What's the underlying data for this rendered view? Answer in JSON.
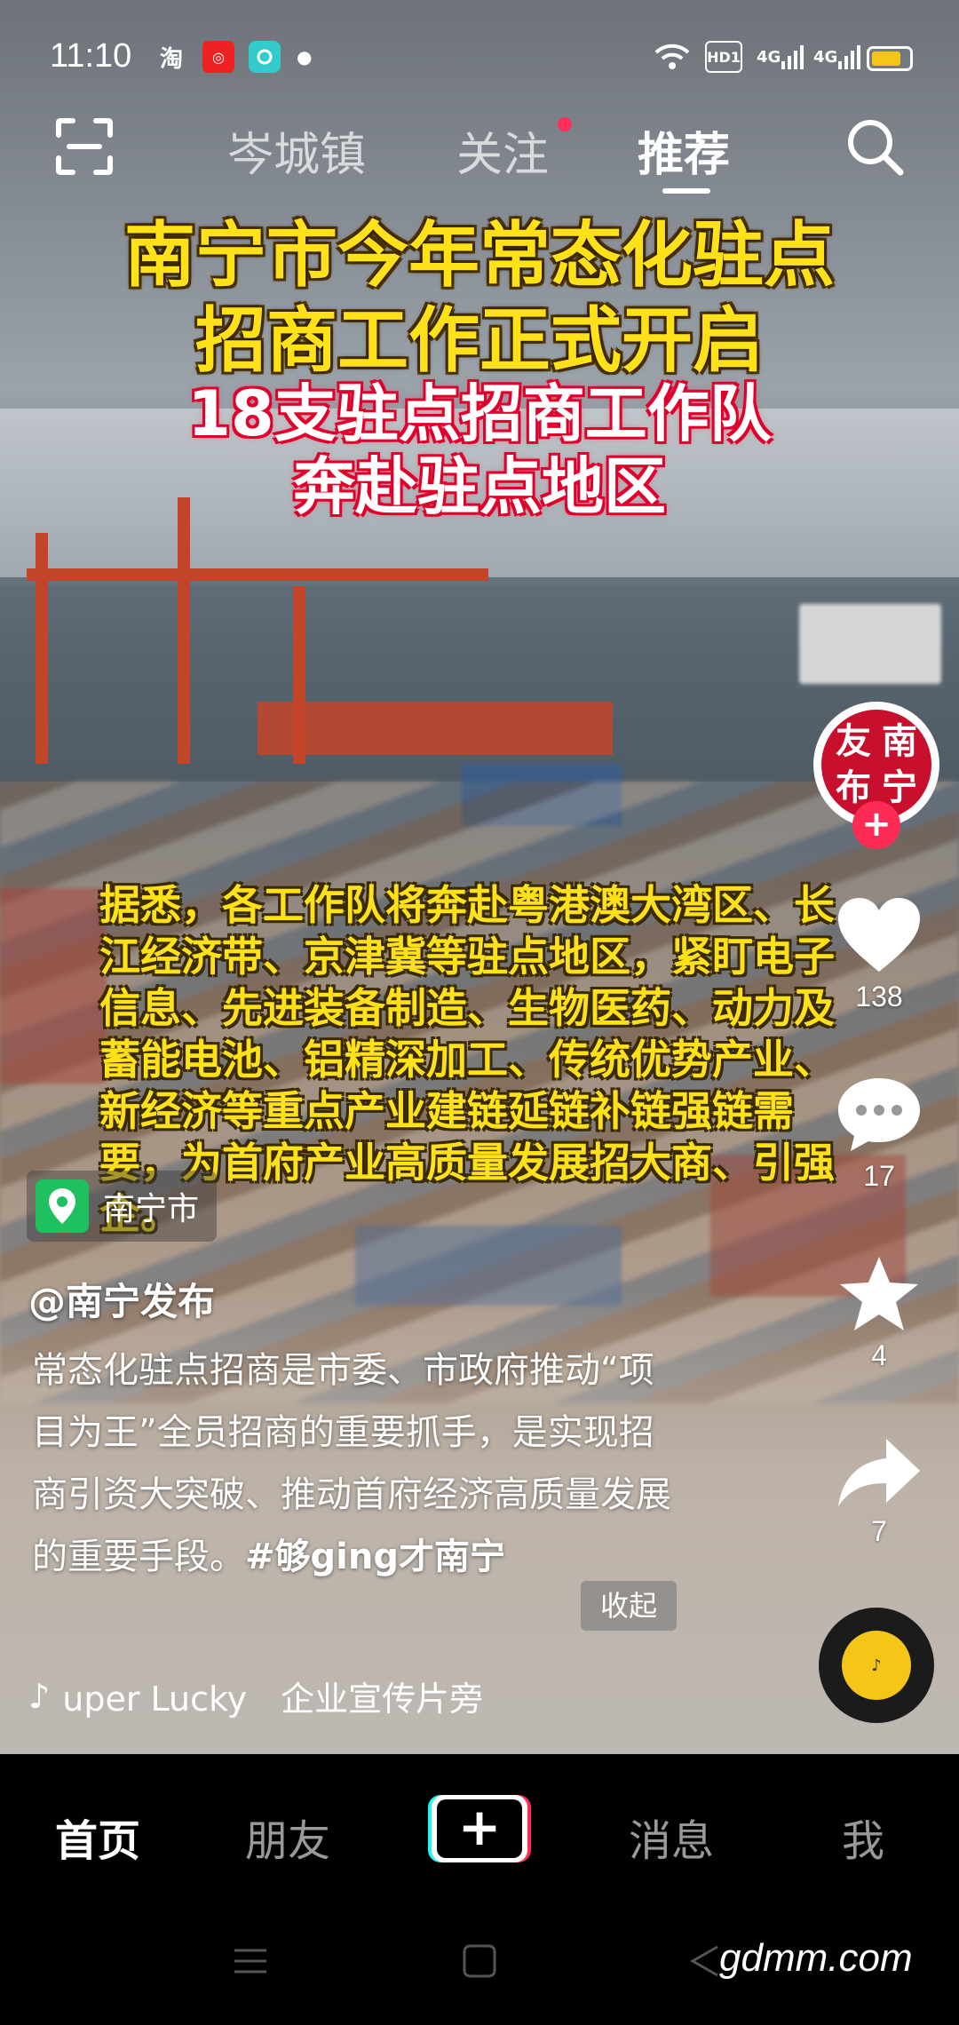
{
  "status_bar": {
    "time": "11:10",
    "app_icons": [
      "淘",
      "poi-icon",
      "app-icon"
    ],
    "network": [
      "HD1",
      "4G",
      "4G"
    ]
  },
  "top_nav": {
    "tabs": [
      {
        "label": "岑城镇",
        "active": false
      },
      {
        "label": "关注",
        "active": false,
        "has_dot": true
      },
      {
        "label": "推荐",
        "active": true
      }
    ]
  },
  "video": {
    "headline_line1": "南宁市今年常态化驻点",
    "headline_line2": "招商工作正式开启",
    "sub_line1": "18支驻点招商工作队",
    "sub_line2": "奔赴驻点地区",
    "overlay_body": "据悉，各工作队将奔赴粤港澳大湾区、长江经济带、京津冀等驻点地区，紧盯电子信息、先进装备制造、生物医药、动力及蓄能电池、铝精深加工、传统优势产业、新经济等重点产业建链延链补链强链需要，为首府产业高质量发展招大商、引强企。",
    "location": "南宁市",
    "author": "@南宁发布",
    "caption": "常态化驻点招商是市委、市政府推动“项目为王”全员招商的重要抓手，是实现招商引资大突破、推动首府经济高质量发展的重要手段。",
    "hashtag": "#够ging才南宁",
    "collapse_label": "收起",
    "music": "uper Lucky　企业宣传片旁"
  },
  "actions": {
    "avatar_text": [
      "友",
      "南",
      "布",
      "宁"
    ],
    "likes": "138",
    "comments": "17",
    "favorites": "4",
    "shares": "7"
  },
  "bottom_nav": {
    "items": [
      "首页",
      "朋友",
      "+",
      "消息",
      "我"
    ]
  },
  "watermark": "gdmm.com",
  "colors": {
    "accent": "#fe2c55",
    "headline_yellow": "#ffe11a",
    "location_green": "#1fc15f"
  }
}
